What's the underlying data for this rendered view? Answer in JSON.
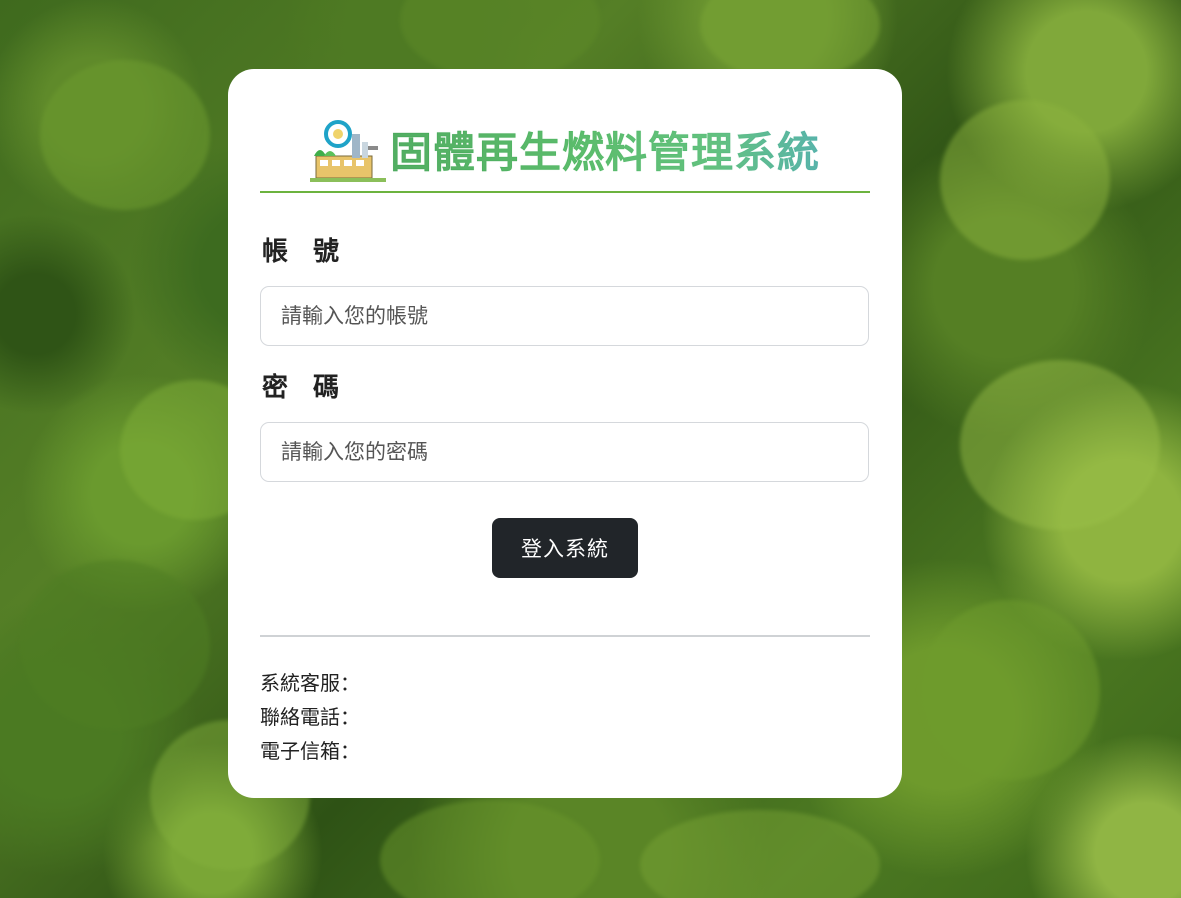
{
  "header": {
    "logo_icon": "recycling-plant-icon",
    "system_title": "固體再生燃料管理系統"
  },
  "form": {
    "account_label": "帳 號",
    "account_placeholder": "請輸入您的帳號",
    "password_label": "密 碼",
    "password_placeholder": "請輸入您的密碼",
    "login_button": "登入系統"
  },
  "contact": {
    "service_label": "系統客服：",
    "phone_label": "聯絡電話：",
    "email_label": "電子信箱："
  },
  "colors": {
    "accent_green": "#6cb33f",
    "button_dark": "#212529",
    "card_bg": "#ffffff"
  }
}
